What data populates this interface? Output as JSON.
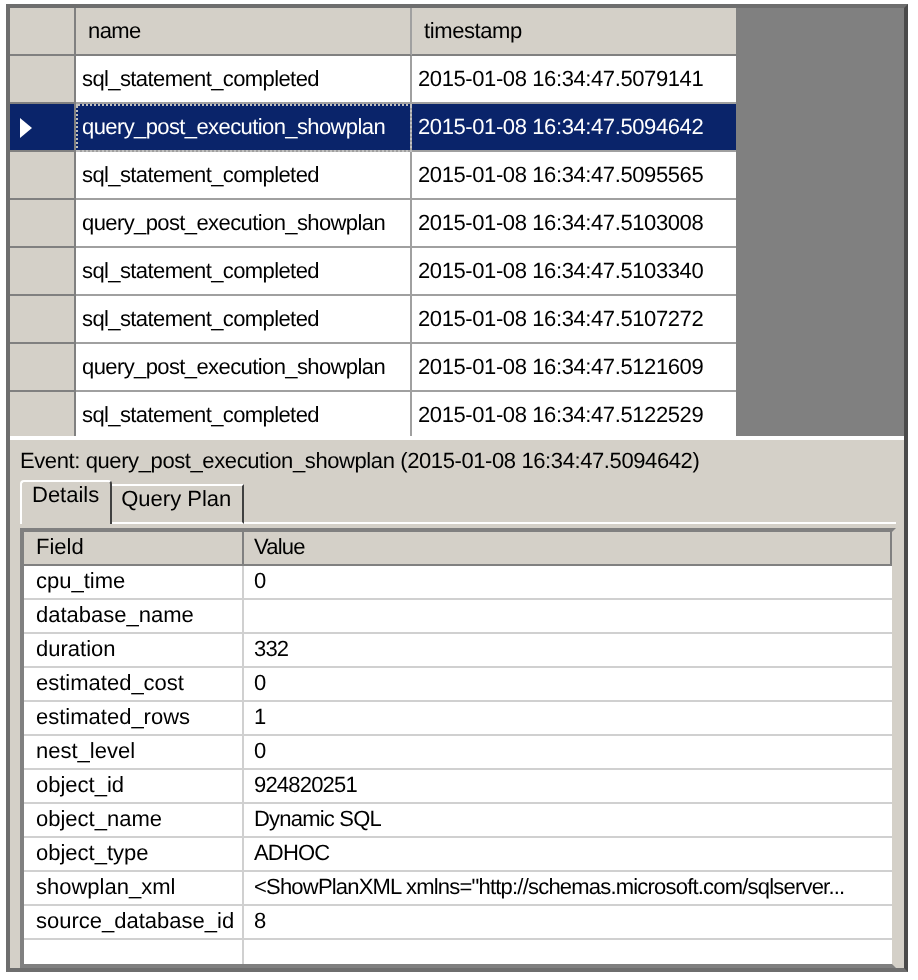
{
  "events": {
    "columns": [
      "name",
      "timestamp"
    ],
    "rows": [
      {
        "name": "sql_statement_completed",
        "timestamp": "2015-01-08 16:34:47.5079141",
        "selected": false
      },
      {
        "name": "query_post_execution_showplan",
        "timestamp": "2015-01-08 16:34:47.5094642",
        "selected": true
      },
      {
        "name": "sql_statement_completed",
        "timestamp": "2015-01-08 16:34:47.5095565",
        "selected": false
      },
      {
        "name": "query_post_execution_showplan",
        "timestamp": "2015-01-08 16:34:47.5103008",
        "selected": false
      },
      {
        "name": "sql_statement_completed",
        "timestamp": "2015-01-08 16:34:47.5103340",
        "selected": false
      },
      {
        "name": "sql_statement_completed",
        "timestamp": "2015-01-08 16:34:47.5107272",
        "selected": false
      },
      {
        "name": "query_post_execution_showplan",
        "timestamp": "2015-01-08 16:34:47.5121609",
        "selected": false
      },
      {
        "name": "sql_statement_completed",
        "timestamp": "2015-01-08 16:34:47.5122529",
        "selected": false
      }
    ]
  },
  "details": {
    "event_label": "Event: query_post_execution_showplan (2015-01-08 16:34:47.5094642)",
    "tabs": [
      {
        "label": "Details",
        "selected": true
      },
      {
        "label": "Query Plan",
        "selected": false
      }
    ],
    "columns": [
      "Field",
      "Value"
    ],
    "rows": [
      {
        "field": "cpu_time",
        "value": "0"
      },
      {
        "field": "database_name"
      },
      {
        "field": "duration",
        "value": "332"
      },
      {
        "field": "estimated_cost",
        "value": "0"
      },
      {
        "field": "estimated_rows",
        "value": "1"
      },
      {
        "field": "nest_level",
        "value": "0"
      },
      {
        "field": "object_id",
        "value": "924820251"
      },
      {
        "field": "object_name",
        "value": "Dynamic SQL"
      },
      {
        "field": "object_type",
        "value": "ADHOC"
      },
      {
        "field": "showplan_xml",
        "value": "<ShowPlanXML xmlns=\"http://schemas.microsoft.com/sqlserver..."
      },
      {
        "field": "source_database_id",
        "value": "8"
      }
    ]
  }
}
